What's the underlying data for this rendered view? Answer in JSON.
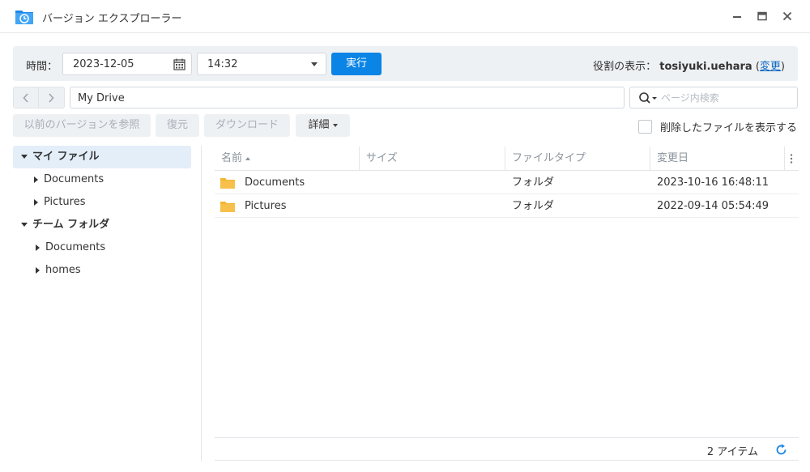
{
  "window": {
    "title": "バージョン エクスプローラー"
  },
  "toolbar": {
    "time_label": "時間：",
    "date_value": "2023-12-05",
    "time_value": "14:32",
    "run_label": "実行",
    "role_prefix": "役割の表示：",
    "role_user": "tosiyuki.uehara",
    "role_open_paren": "(",
    "role_change": "変更",
    "role_close_paren": ")"
  },
  "nav": {
    "path": "My Drive",
    "search_placeholder": "ページ内検索"
  },
  "actions": {
    "browse_previous": "以前のバージョンを参照",
    "restore": "復元",
    "download": "ダウンロード",
    "details": "詳細",
    "show_deleted": "削除したファイルを表示する"
  },
  "tree": [
    {
      "label": "マイ ファイル",
      "level": 0,
      "expanded": true,
      "selected": true
    },
    {
      "label": "Documents",
      "level": 1,
      "expanded": false
    },
    {
      "label": "Pictures",
      "level": 1,
      "expanded": false
    },
    {
      "label": "チーム フォルダ",
      "level": 0,
      "expanded": true
    },
    {
      "label": "Documents",
      "level": 1,
      "expanded": false
    },
    {
      "label": "homes",
      "level": 1,
      "expanded": false
    }
  ],
  "list": {
    "columns": [
      "名前",
      "サイズ",
      "ファイルタイプ",
      "変更日"
    ],
    "rows": [
      {
        "name": "Documents",
        "size": "",
        "type": "フォルダ",
        "modified": "2023-10-16 16:48:11"
      },
      {
        "name": "Pictures",
        "size": "",
        "type": "フォルダ",
        "modified": "2022-09-14 05:54:49"
      }
    ],
    "item_count": "2 アイテム"
  },
  "colors": {
    "accent": "#0a84e5",
    "toolbar_bg": "#eef1f4",
    "selected_bg": "#e3eef9",
    "folder": "#f7c04a"
  }
}
